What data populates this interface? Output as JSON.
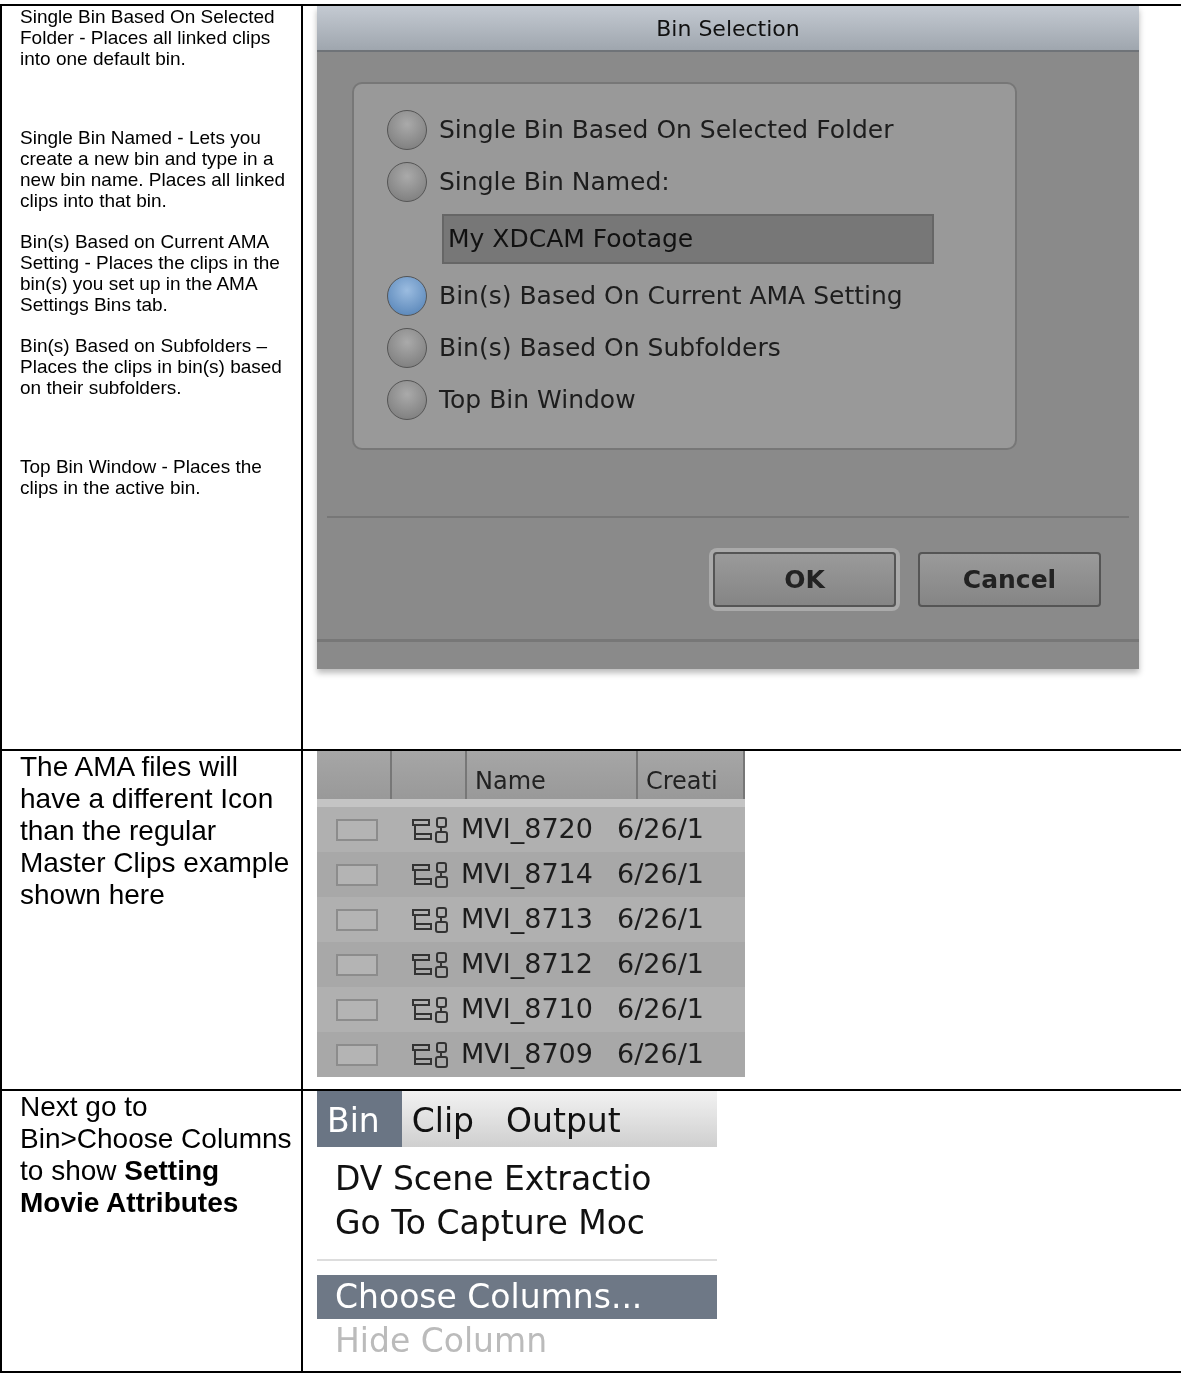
{
  "document_table": {
    "rows": [
      {
        "notes": [
          "Single Bin Based On Selected Folder  - Places all linked clips into one default bin.",
          "Single Bin Named - Lets you create a new bin and type in a new bin name. Places all linked clips into that bin.",
          "Bin(s) Based on Current AMA Setting - Places the clips in the bin(s) you set up in the AMA Settings Bins tab.",
          "Bin(s) Based on Subfolders – Places the clips in bin(s) based on their subfolders.",
          "Top Bin Window - Places the clips in the active bin."
        ],
        "screenshot": {
          "kind": "dialog",
          "title": "Bin Selection",
          "options": [
            {
              "label": "Single Bin Based On Selected Folder",
              "selected": false
            },
            {
              "label": "Single Bin Named:",
              "selected": false,
              "field_value": "My XDCAM Footage"
            },
            {
              "label": "Bin(s) Based On Current AMA Setting",
              "selected": true
            },
            {
              "label": "Bin(s) Based On Subfolders",
              "selected": false
            },
            {
              "label": "Top Bin Window",
              "selected": false
            }
          ],
          "buttons": [
            {
              "label": "OK",
              "default": true
            },
            {
              "label": "Cancel",
              "default": false
            }
          ]
        }
      },
      {
        "notes": [
          "The AMA files will have a different Icon than the regular Master Clips example shown here"
        ],
        "screenshot": {
          "kind": "bin",
          "columns": [
            "Name",
            "Creati"
          ],
          "rows": [
            {
              "name": "MVI_8720",
              "column_4": "6/26/1"
            },
            {
              "name": "MVI_8714",
              "column_4": "6/26/1"
            },
            {
              "name": "MVI_8713",
              "column_4": "6/26/1"
            },
            {
              "name": "MVI_8712",
              "column_4": "6/26/1"
            },
            {
              "name": "MVI_8710",
              "column_4": "6/26/1"
            },
            {
              "name": "MVI_8709",
              "column_4": "6/26/1"
            }
          ]
        }
      },
      {
        "notes": [
          "Next go to Bin>Choose Columns to show **Setting Movie Attributes**"
        ],
        "screenshot": {
          "kind": "menu",
          "menubar": [
            {
              "label": "Bin",
              "selected": true
            },
            {
              "label": "Clip",
              "selected": false
            },
            {
              "label": "Output",
              "selected": false
            }
          ],
          "items": [
            {
              "kind": "item",
              "label": "DV Scene Extractio",
              "selected": false,
              "disabled": false
            },
            {
              "kind": "item",
              "label": "Go To Capture Moc",
              "selected": false,
              "disabled": false
            },
            {
              "kind": "separator"
            },
            {
              "kind": "item",
              "label": "Choose Columns...",
              "selected": true,
              "disabled": false
            },
            {
              "kind": "item",
              "label": "Hide Column",
              "selected": false,
              "disabled": true
            }
          ]
        }
      }
    ]
  }
}
